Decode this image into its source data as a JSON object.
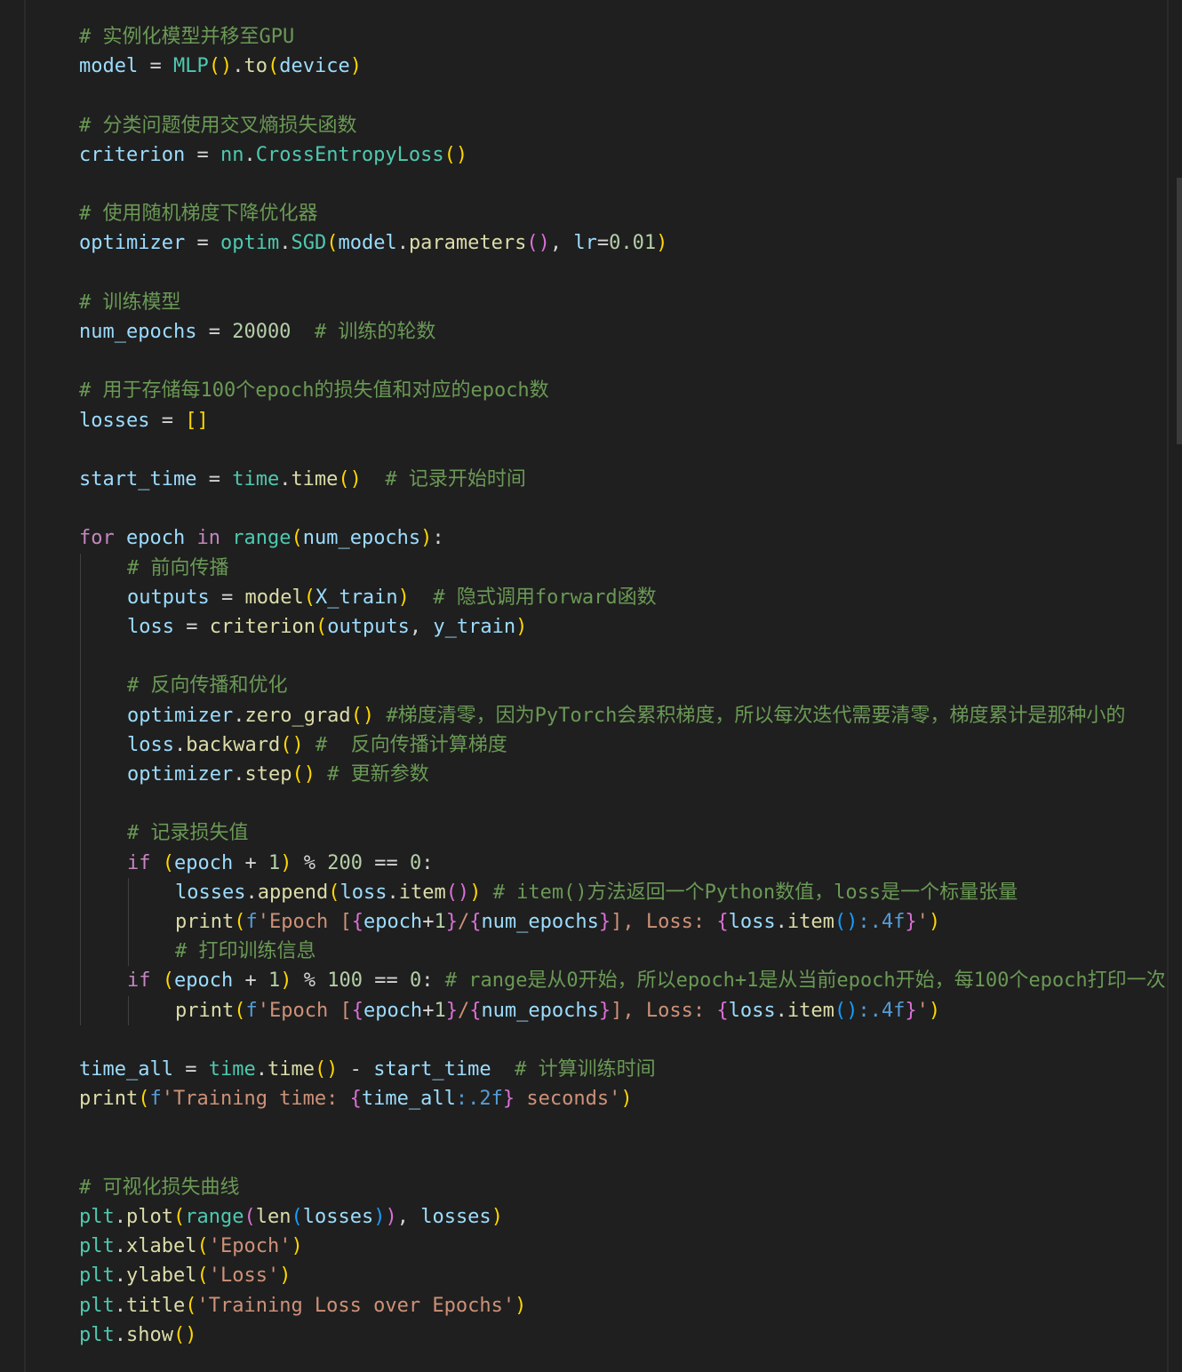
{
  "editor": {
    "language": "python",
    "theme_colors": {
      "background": "#1f1f1f",
      "variable": "#9cdcfe",
      "class": "#4ec9b0",
      "function": "#dcdcaa",
      "keyword": "#c586c0",
      "operator": "#d4d4d4",
      "number": "#b5cea8",
      "string": "#ce9178",
      "comment": "#6a9955",
      "bracket_level1": "#ffd700",
      "bracket_level2": "#da70d6",
      "bracket_level3": "#179fff"
    },
    "lines": [
      {
        "indent": 0,
        "tokens": [
          [
            "# 实例化模型并移至GPU",
            "com"
          ]
        ]
      },
      {
        "indent": 0,
        "tokens": [
          [
            "model",
            "var"
          ],
          [
            " = ",
            "op"
          ],
          [
            "MLP",
            "cls"
          ],
          [
            "()",
            "p1"
          ],
          [
            ".",
            "op"
          ],
          [
            "to",
            "fn"
          ],
          [
            "(",
            "p1"
          ],
          [
            "device",
            "var"
          ],
          [
            ")",
            "p1"
          ]
        ]
      },
      {
        "indent": 0,
        "tokens": []
      },
      {
        "indent": 0,
        "tokens": [
          [
            "# 分类问题使用交叉熵损失函数",
            "com"
          ]
        ]
      },
      {
        "indent": 0,
        "tokens": [
          [
            "criterion",
            "var"
          ],
          [
            " = ",
            "op"
          ],
          [
            "nn",
            "cls"
          ],
          [
            ".",
            "op"
          ],
          [
            "CrossEntropyLoss",
            "cls"
          ],
          [
            "()",
            "p1"
          ]
        ]
      },
      {
        "indent": 0,
        "tokens": []
      },
      {
        "indent": 0,
        "tokens": [
          [
            "# 使用随机梯度下降优化器",
            "com"
          ]
        ]
      },
      {
        "indent": 0,
        "tokens": [
          [
            "optimizer",
            "var"
          ],
          [
            " = ",
            "op"
          ],
          [
            "optim",
            "cls"
          ],
          [
            ".",
            "op"
          ],
          [
            "SGD",
            "cls"
          ],
          [
            "(",
            "p1"
          ],
          [
            "model",
            "var"
          ],
          [
            ".",
            "op"
          ],
          [
            "parameters",
            "fn"
          ],
          [
            "()",
            "p2"
          ],
          [
            ", ",
            "op"
          ],
          [
            "lr",
            "var"
          ],
          [
            "=",
            "op"
          ],
          [
            "0.01",
            "num"
          ],
          [
            ")",
            "p1"
          ]
        ]
      },
      {
        "indent": 0,
        "tokens": []
      },
      {
        "indent": 0,
        "tokens": [
          [
            "# 训练模型",
            "com"
          ]
        ]
      },
      {
        "indent": 0,
        "tokens": [
          [
            "num_epochs",
            "var"
          ],
          [
            " = ",
            "op"
          ],
          [
            "20000",
            "num"
          ],
          [
            "  ",
            "op"
          ],
          [
            "# 训练的轮数",
            "com"
          ]
        ]
      },
      {
        "indent": 0,
        "tokens": []
      },
      {
        "indent": 0,
        "tokens": [
          [
            "# 用于存储每100个epoch的损失值和对应的epoch数",
            "com"
          ]
        ]
      },
      {
        "indent": 0,
        "tokens": [
          [
            "losses",
            "var"
          ],
          [
            " = ",
            "op"
          ],
          [
            "[]",
            "p1"
          ]
        ]
      },
      {
        "indent": 0,
        "tokens": []
      },
      {
        "indent": 0,
        "tokens": [
          [
            "start_time",
            "var"
          ],
          [
            " = ",
            "op"
          ],
          [
            "time",
            "cls"
          ],
          [
            ".",
            "op"
          ],
          [
            "time",
            "fn"
          ],
          [
            "()",
            "p1"
          ],
          [
            "  ",
            "op"
          ],
          [
            "# 记录开始时间",
            "com"
          ]
        ]
      },
      {
        "indent": 0,
        "tokens": []
      },
      {
        "indent": 0,
        "tokens": [
          [
            "for",
            "kw"
          ],
          [
            " ",
            "op"
          ],
          [
            "epoch",
            "var"
          ],
          [
            " ",
            "op"
          ],
          [
            "in",
            "kw"
          ],
          [
            " ",
            "op"
          ],
          [
            "range",
            "cls"
          ],
          [
            "(",
            "p1"
          ],
          [
            "num_epochs",
            "var"
          ],
          [
            ")",
            "p1"
          ],
          [
            ":",
            "op"
          ]
        ]
      },
      {
        "indent": 1,
        "tokens": [
          [
            "# 前向传播",
            "com"
          ]
        ]
      },
      {
        "indent": 1,
        "tokens": [
          [
            "outputs",
            "var"
          ],
          [
            " = ",
            "op"
          ],
          [
            "model",
            "fn"
          ],
          [
            "(",
            "p1"
          ],
          [
            "X_train",
            "var"
          ],
          [
            ")",
            "p1"
          ],
          [
            "  ",
            "op"
          ],
          [
            "# 隐式调用forward函数",
            "com"
          ]
        ]
      },
      {
        "indent": 1,
        "tokens": [
          [
            "loss",
            "var"
          ],
          [
            " = ",
            "op"
          ],
          [
            "criterion",
            "fn"
          ],
          [
            "(",
            "p1"
          ],
          [
            "outputs",
            "var"
          ],
          [
            ", ",
            "op"
          ],
          [
            "y_train",
            "var"
          ],
          [
            ")",
            "p1"
          ]
        ]
      },
      {
        "indent": 1,
        "tokens": []
      },
      {
        "indent": 1,
        "tokens": [
          [
            "# 反向传播和优化",
            "com"
          ]
        ]
      },
      {
        "indent": 1,
        "tokens": [
          [
            "optimizer",
            "var"
          ],
          [
            ".",
            "op"
          ],
          [
            "zero_grad",
            "fn"
          ],
          [
            "()",
            "p1"
          ],
          [
            " ",
            "op"
          ],
          [
            "#梯度清零，因为PyTorch会累积梯度，所以每次迭代需要清零，梯度累计是那种小的",
            "com"
          ]
        ]
      },
      {
        "indent": 1,
        "tokens": [
          [
            "loss",
            "var"
          ],
          [
            ".",
            "op"
          ],
          [
            "backward",
            "fn"
          ],
          [
            "()",
            "p1"
          ],
          [
            " ",
            "op"
          ],
          [
            "#  反向传播计算梯度",
            "com"
          ]
        ]
      },
      {
        "indent": 1,
        "tokens": [
          [
            "optimizer",
            "var"
          ],
          [
            ".",
            "op"
          ],
          [
            "step",
            "fn"
          ],
          [
            "()",
            "p1"
          ],
          [
            " ",
            "op"
          ],
          [
            "# 更新参数",
            "com"
          ]
        ]
      },
      {
        "indent": 1,
        "tokens": []
      },
      {
        "indent": 1,
        "tokens": [
          [
            "# 记录损失值",
            "com"
          ]
        ]
      },
      {
        "indent": 1,
        "tokens": [
          [
            "if",
            "kw"
          ],
          [
            " ",
            "op"
          ],
          [
            "(",
            "p1"
          ],
          [
            "epoch",
            "var"
          ],
          [
            " + ",
            "op"
          ],
          [
            "1",
            "num"
          ],
          [
            ")",
            "p1"
          ],
          [
            " % ",
            "op"
          ],
          [
            "200",
            "num"
          ],
          [
            " == ",
            "op"
          ],
          [
            "0",
            "num"
          ],
          [
            ":",
            "op"
          ]
        ]
      },
      {
        "indent": 2,
        "tokens": [
          [
            "losses",
            "var"
          ],
          [
            ".",
            "op"
          ],
          [
            "append",
            "fn"
          ],
          [
            "(",
            "p1"
          ],
          [
            "loss",
            "var"
          ],
          [
            ".",
            "op"
          ],
          [
            "item",
            "fn"
          ],
          [
            "()",
            "p2"
          ],
          [
            ")",
            "p1"
          ],
          [
            " ",
            "op"
          ],
          [
            "# item()方法返回一个Python数值，loss是一个标量张量",
            "com"
          ]
        ]
      },
      {
        "indent": 2,
        "tokens": [
          [
            "print",
            "fn"
          ],
          [
            "(",
            "p1"
          ],
          [
            "f",
            "kwb"
          ],
          [
            "'Epoch ",
            "str"
          ],
          [
            "[",
            "str"
          ],
          [
            "{",
            "p2"
          ],
          [
            "epoch",
            "var"
          ],
          [
            "+",
            "op"
          ],
          [
            "1",
            "num"
          ],
          [
            "}",
            "p2"
          ],
          [
            "/",
            "str"
          ],
          [
            "{",
            "p2"
          ],
          [
            "num_epochs",
            "var"
          ],
          [
            "}",
            "p2"
          ],
          [
            "], Loss: ",
            "str"
          ],
          [
            "{",
            "p2"
          ],
          [
            "loss",
            "var"
          ],
          [
            ".",
            "op"
          ],
          [
            "item",
            "fn"
          ],
          [
            "()",
            "p3"
          ],
          [
            ":.4f",
            "kwb"
          ],
          [
            "}",
            "p2"
          ],
          [
            "'",
            "str"
          ],
          [
            ")",
            "p1"
          ]
        ]
      },
      {
        "indent": 2,
        "tokens": [
          [
            "# 打印训练信息",
            "com"
          ]
        ]
      },
      {
        "indent": 1,
        "tokens": [
          [
            "if",
            "kw"
          ],
          [
            " ",
            "op"
          ],
          [
            "(",
            "p1"
          ],
          [
            "epoch",
            "var"
          ],
          [
            " + ",
            "op"
          ],
          [
            "1",
            "num"
          ],
          [
            ")",
            "p1"
          ],
          [
            " % ",
            "op"
          ],
          [
            "100",
            "num"
          ],
          [
            " == ",
            "op"
          ],
          [
            "0",
            "num"
          ],
          [
            ":",
            "op"
          ],
          [
            " ",
            "op"
          ],
          [
            "# range是从0开始，所以epoch+1是从当前epoch开始，每100个epoch打印一次",
            "com"
          ]
        ]
      },
      {
        "indent": 2,
        "tokens": [
          [
            "print",
            "fn"
          ],
          [
            "(",
            "p1"
          ],
          [
            "f",
            "kwb"
          ],
          [
            "'Epoch ",
            "str"
          ],
          [
            "[",
            "str"
          ],
          [
            "{",
            "p2"
          ],
          [
            "epoch",
            "var"
          ],
          [
            "+",
            "op"
          ],
          [
            "1",
            "num"
          ],
          [
            "}",
            "p2"
          ],
          [
            "/",
            "str"
          ],
          [
            "{",
            "p2"
          ],
          [
            "num_epochs",
            "var"
          ],
          [
            "}",
            "p2"
          ],
          [
            "], Loss: ",
            "str"
          ],
          [
            "{",
            "p2"
          ],
          [
            "loss",
            "var"
          ],
          [
            ".",
            "op"
          ],
          [
            "item",
            "fn"
          ],
          [
            "()",
            "p3"
          ],
          [
            ":.4f",
            "kwb"
          ],
          [
            "}",
            "p2"
          ],
          [
            "'",
            "str"
          ],
          [
            ")",
            "p1"
          ]
        ]
      },
      {
        "indent": 0,
        "tokens": []
      },
      {
        "indent": 0,
        "tokens": [
          [
            "time_all",
            "var"
          ],
          [
            " = ",
            "op"
          ],
          [
            "time",
            "cls"
          ],
          [
            ".",
            "op"
          ],
          [
            "time",
            "fn"
          ],
          [
            "()",
            "p1"
          ],
          [
            " - ",
            "op"
          ],
          [
            "start_time",
            "var"
          ],
          [
            "  ",
            "op"
          ],
          [
            "# 计算训练时间",
            "com"
          ]
        ]
      },
      {
        "indent": 0,
        "tokens": [
          [
            "print",
            "fn"
          ],
          [
            "(",
            "p1"
          ],
          [
            "f",
            "kwb"
          ],
          [
            "'Training time: ",
            "str"
          ],
          [
            "{",
            "p2"
          ],
          [
            "time_all",
            "var"
          ],
          [
            ":.2f",
            "kwb"
          ],
          [
            "}",
            "p2"
          ],
          [
            " seconds'",
            "str"
          ],
          [
            ")",
            "p1"
          ]
        ]
      },
      {
        "indent": 0,
        "tokens": []
      },
      {
        "indent": 0,
        "tokens": []
      },
      {
        "indent": 0,
        "tokens": [
          [
            "# 可视化损失曲线",
            "com"
          ]
        ]
      },
      {
        "indent": 0,
        "tokens": [
          [
            "plt",
            "cls"
          ],
          [
            ".",
            "op"
          ],
          [
            "plot",
            "fn"
          ],
          [
            "(",
            "p1"
          ],
          [
            "range",
            "cls"
          ],
          [
            "(",
            "p2"
          ],
          [
            "len",
            "fn"
          ],
          [
            "(",
            "p3"
          ],
          [
            "losses",
            "var"
          ],
          [
            ")",
            "p3"
          ],
          [
            ")",
            "p2"
          ],
          [
            ", ",
            "op"
          ],
          [
            "losses",
            "var"
          ],
          [
            ")",
            "p1"
          ]
        ]
      },
      {
        "indent": 0,
        "tokens": [
          [
            "plt",
            "cls"
          ],
          [
            ".",
            "op"
          ],
          [
            "xlabel",
            "fn"
          ],
          [
            "(",
            "p1"
          ],
          [
            "'Epoch'",
            "str"
          ],
          [
            ")",
            "p1"
          ]
        ]
      },
      {
        "indent": 0,
        "tokens": [
          [
            "plt",
            "cls"
          ],
          [
            ".",
            "op"
          ],
          [
            "ylabel",
            "fn"
          ],
          [
            "(",
            "p1"
          ],
          [
            "'Loss'",
            "str"
          ],
          [
            ")",
            "p1"
          ]
        ]
      },
      {
        "indent": 0,
        "tokens": [
          [
            "plt",
            "cls"
          ],
          [
            ".",
            "op"
          ],
          [
            "title",
            "fn"
          ],
          [
            "(",
            "p1"
          ],
          [
            "'Training Loss over Epochs'",
            "str"
          ],
          [
            ")",
            "p1"
          ]
        ]
      },
      {
        "indent": 0,
        "tokens": [
          [
            "plt",
            "cls"
          ],
          [
            ".",
            "op"
          ],
          [
            "show",
            "fn"
          ],
          [
            "()",
            "p1"
          ]
        ]
      }
    ]
  }
}
